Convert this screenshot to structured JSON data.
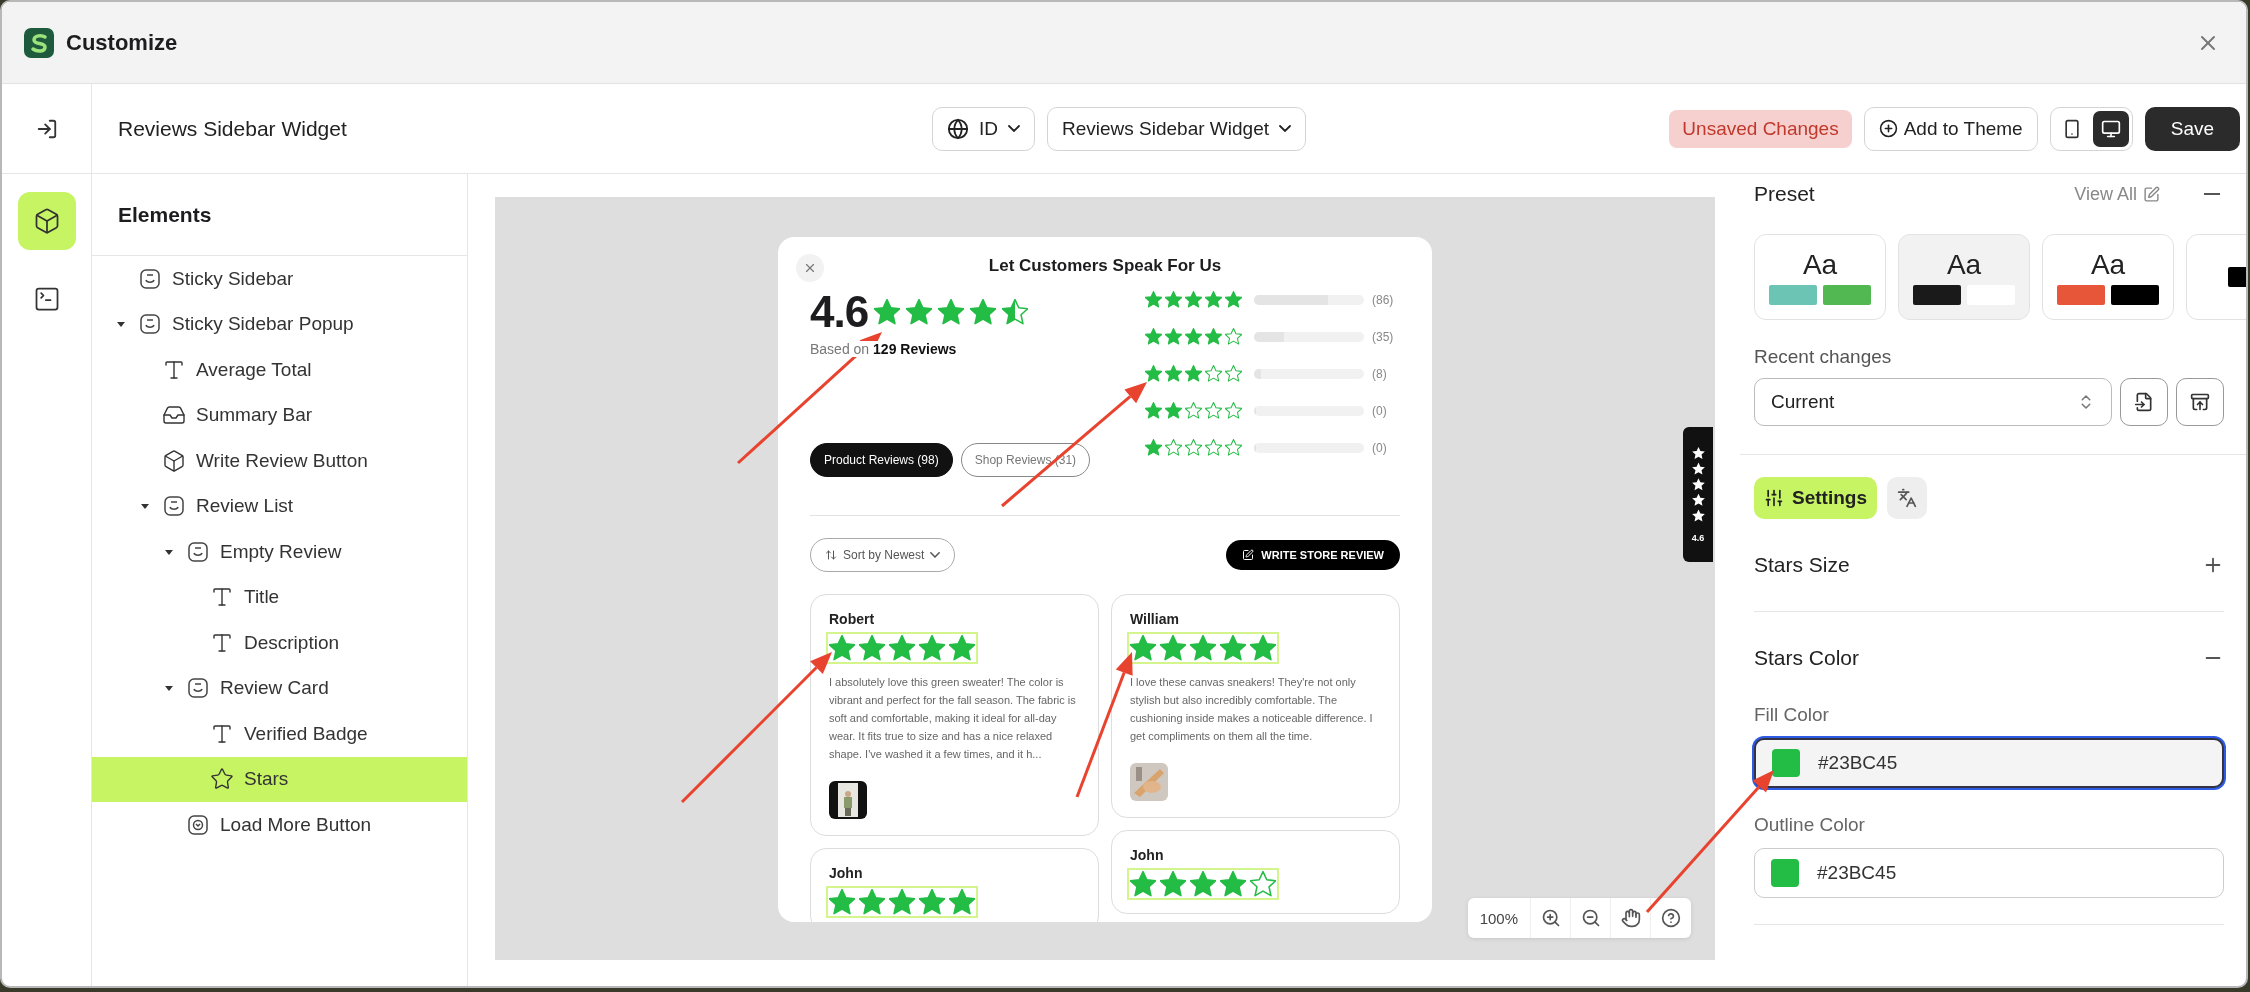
{
  "window": {
    "title": "Customize"
  },
  "header": {
    "title": "Reviews Sidebar Widget",
    "language": "ID",
    "widget": "Reviews Sidebar Widget",
    "status": "Unsaved Changes",
    "add_button": "Add to Theme",
    "devices": [
      {
        "kind": "mobile",
        "selected": false
      },
      {
        "kind": "desktop",
        "selected": true
      }
    ],
    "save_button": "Save"
  },
  "rail": [
    {
      "kind": "elements",
      "selected": true
    },
    {
      "kind": "code",
      "selected": false
    }
  ],
  "elements": {
    "title": "Elements",
    "tree": [
      {
        "label": "Sticky Sidebar",
        "kind": "container",
        "selected": false
      },
      {
        "label": "Sticky Sidebar Popup",
        "kind": "container",
        "selected": false,
        "expanded": true,
        "children": [
          {
            "label": "Average Total",
            "kind": "text",
            "selected": false
          },
          {
            "label": "Summary Bar",
            "kind": "tray",
            "selected": false
          },
          {
            "label": "Write Review Button",
            "kind": "cube",
            "selected": false
          },
          {
            "label": "Review List",
            "kind": "container",
            "selected": false,
            "expanded": true,
            "children": [
              {
                "label": "Empty Review",
                "kind": "container",
                "selected": false,
                "expanded": true,
                "children": [
                  {
                    "label": "Title",
                    "kind": "text",
                    "selected": false
                  },
                  {
                    "label": "Description",
                    "kind": "text",
                    "selected": false
                  }
                ]
              },
              {
                "label": "Review Card",
                "kind": "container",
                "selected": false,
                "expanded": true,
                "children": [
                  {
                    "label": "Verified Badge",
                    "kind": "text",
                    "selected": false
                  },
                  {
                    "label": "Stars",
                    "kind": "star",
                    "selected": true
                  }
                ]
              },
              {
                "label": "Load More Button",
                "kind": "button",
                "selected": false
              }
            ]
          }
        ]
      }
    ]
  },
  "preview": {
    "title": "Let Customers Speak For Us",
    "average": "4.6",
    "stars": 4.5,
    "based_on": "Based on **129 Reviews**",
    "breakdown": [
      {
        "stars": 5,
        "level": 0.67,
        "count": "(86)"
      },
      {
        "stars": 4,
        "level": 0.27,
        "count": "(35)"
      },
      {
        "stars": 3,
        "level": 0.06,
        "count": "(8)"
      },
      {
        "stars": 2,
        "level": 0,
        "count": "(0)"
      },
      {
        "stars": 1,
        "level": 0,
        "count": "(0)"
      }
    ],
    "tabs": [
      {
        "label": "Product Reviews (98)",
        "selected": true
      },
      {
        "label": "Shop Reviews (31)",
        "selected": false
      }
    ],
    "sort": "Sort by Newest",
    "write_button": "WRITE STORE REVIEW",
    "highlight_stars": true,
    "review_columns": [
      [
        {
          "name": "Robert",
          "stars": 5,
          "text": "I absolutely love this green sweater! The color is vibrant and perfect for the fall season. The fabric is soft and comfortable, making it ideal for all-day wear. It fits true to size and has a nice relaxed shape. I've washed it a few times, and it h...",
          "photo": true
        },
        {
          "name": "John",
          "stars": 5
        }
      ],
      [
        {
          "name": "William",
          "stars": 5,
          "text": "I love these canvas sneakers! They're not only stylish but also incredibly comfortable. The cushioning inside makes a noticeable difference. I get compliments on them all the time.",
          "photo": true
        },
        {
          "name": "John",
          "stars": 4
        }
      ]
    ],
    "side_tab": {
      "rating": "4.6"
    },
    "zoom_label": "100%"
  },
  "inspector": {
    "preset_title": "Preset",
    "view_all": "View All",
    "presets": [
      {
        "label": "Aa",
        "swatches": [
          {
            "color": "#6cc4b4"
          },
          {
            "color": "#52b852"
          }
        ],
        "selected": false
      },
      {
        "label": "Aa",
        "swatches": [
          {
            "color": "#1a1a1a"
          },
          {
            "color": "#ffffff"
          }
        ],
        "selected": true
      },
      {
        "label": "Aa",
        "swatches": [
          {
            "color": "#e8563a"
          },
          {
            "color": "#000000"
          }
        ],
        "selected": false
      },
      {
        "swatches": [
          {
            "color": "#000000"
          }
        ],
        "selected": false
      }
    ],
    "recent_label": "Recent changes",
    "recent_value": "Current",
    "tabs": [
      {
        "kind": "settings",
        "label": "Settings",
        "selected": true
      },
      {
        "kind": "translate",
        "selected": false
      }
    ],
    "sections": [
      {
        "title": "Stars Size",
        "expanded": false
      },
      {
        "title": "Stars Color",
        "expanded": true,
        "fields": [
          {
            "label": "Fill Color",
            "value": "#23BC45",
            "focused": true
          },
          {
            "label": "Outline Color",
            "value": "#23BC45",
            "focused": false
          }
        ]
      }
    ]
  }
}
